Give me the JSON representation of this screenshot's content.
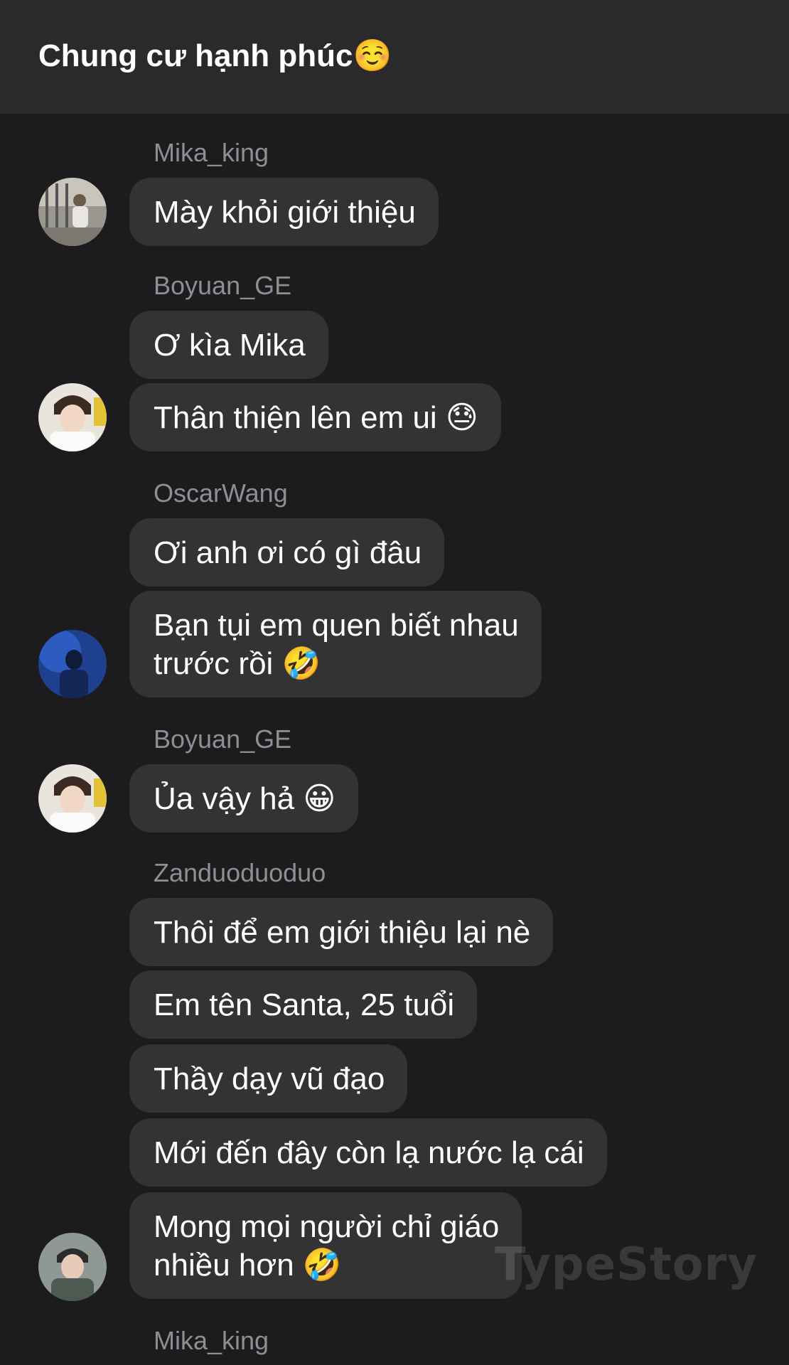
{
  "header": {
    "title": "Chung cư hạnh phúc☺️"
  },
  "messages": [
    {
      "sender": "Mika_king",
      "bubbles": [
        "Mày khỏi giới thiệu"
      ]
    },
    {
      "sender": "Boyuan_GE",
      "bubbles": [
        "Ơ kìa Mika",
        "Thân thiện lên em ui 😓"
      ]
    },
    {
      "sender": "OscarWang",
      "bubbles": [
        "Ơi anh ơi có gì đâu",
        "Bạn tụi em quen biết nhau\ntrước rồi 🤣"
      ]
    },
    {
      "sender": "Boyuan_GE",
      "bubbles": [
        "Ủa vậy hả 😀"
      ]
    },
    {
      "sender": "Zanduoduoduo",
      "bubbles": [
        "Thôi để em giới thiệu lại nè",
        "Em tên Santa, 25 tuổi",
        "Thầy dạy vũ đạo",
        "Mới đến đây còn lạ nước lạ cái",
        "Mong mọi người chỉ giáo\nnhiều hơn 🤣"
      ]
    },
    {
      "sender": "Mika_king",
      "bubbles": []
    }
  ],
  "watermark": "TypeStory",
  "colors": {
    "background": "#1c1c1e",
    "header": "#2a2a2c",
    "bubble": "#333336",
    "sender_name": "#8e8e93",
    "text": "#ffffff"
  },
  "avatars": [
    "avatar-photo-mika-king",
    "avatar-photo-boyuan-ge",
    "avatar-photo-oscarwang",
    "avatar-photo-boyuan-ge",
    "avatar-photo-zanduoduoduo"
  ]
}
